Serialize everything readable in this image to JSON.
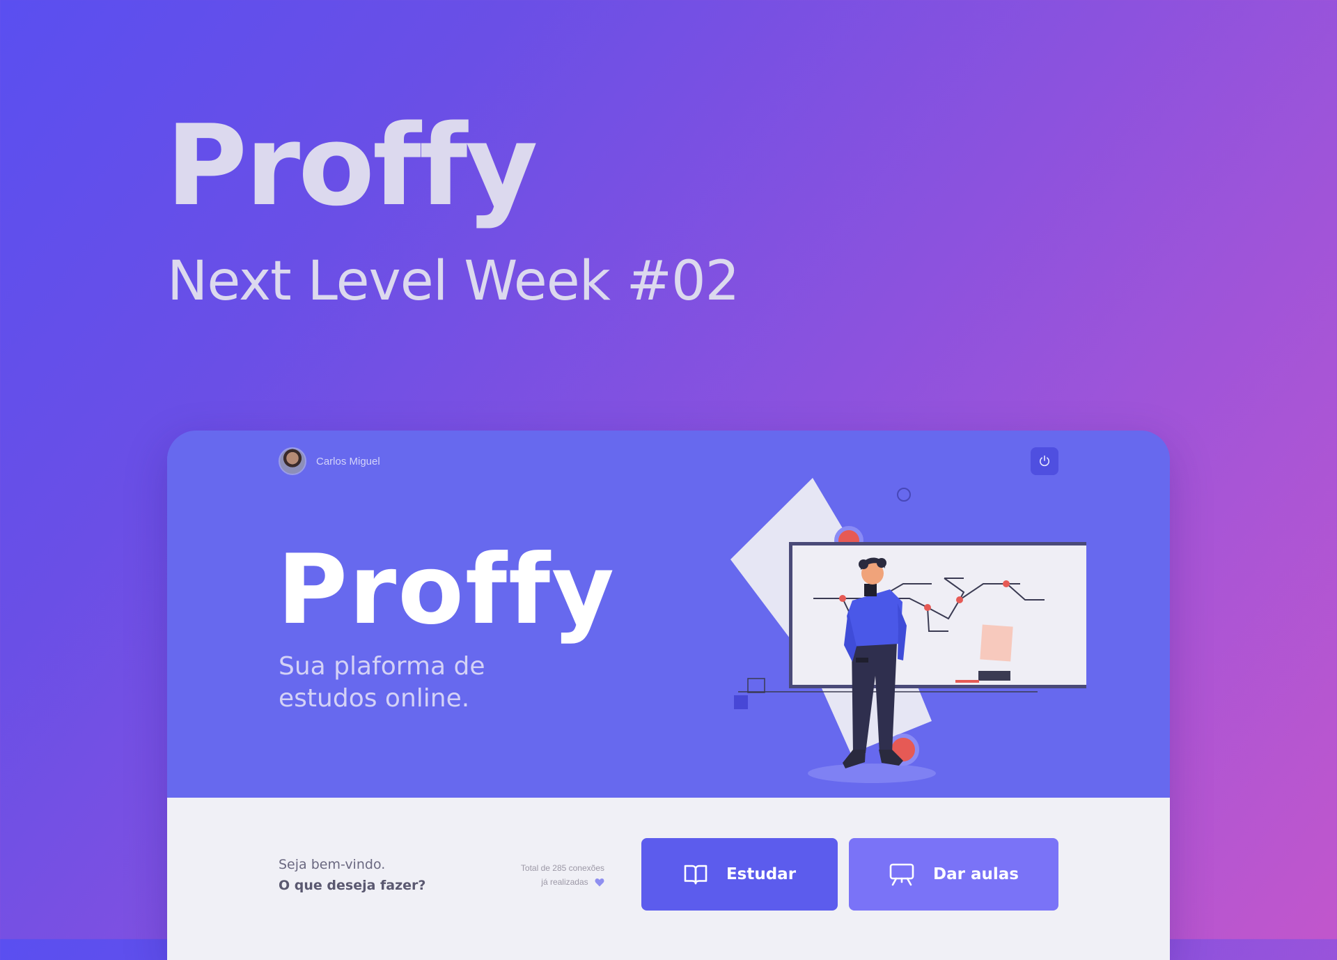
{
  "banner": {
    "title": "Proffy",
    "subtitle": "Next Level Week #02"
  },
  "app": {
    "user": {
      "name": "Carlos Miguel"
    },
    "logo_text": "Proffy",
    "tagline": "Sua plaforma de estudos online.",
    "welcome": {
      "line1": "Seja bem-vindo.",
      "line2": "O que deseja fazer?"
    },
    "connections": {
      "line1": "Total de 285 conexões",
      "line2": "já realizadas"
    },
    "buttons": {
      "study_label": "Estudar",
      "teach_label": "Dar aulas"
    },
    "icons": {
      "logout": "power-icon",
      "study": "book-open-icon",
      "teach": "presentation-board-icon",
      "heart": "heart-icon"
    },
    "colors": {
      "header_background": "#6769ee",
      "footer_background": "#f0f0f6",
      "study_button": "#5c5ced",
      "teach_button": "#7a73f7",
      "accent_red": "#e65a55"
    }
  }
}
